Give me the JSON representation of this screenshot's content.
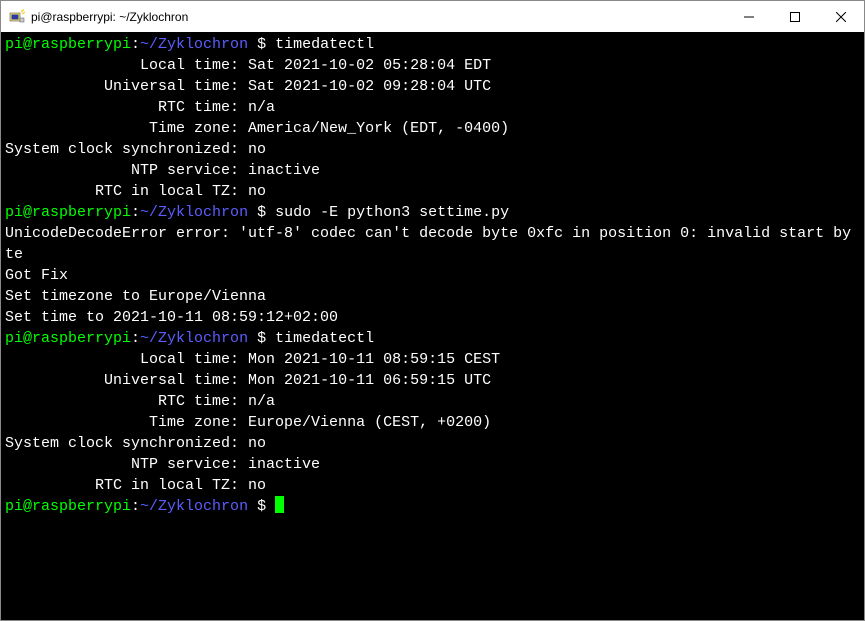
{
  "window": {
    "title": "pi@raspberrypi: ~/Zyklochron"
  },
  "prompt": {
    "user_host": "pi@raspberrypi",
    "separator": ":",
    "path": "~/Zyklochron",
    "symbol": " $ "
  },
  "session": [
    {
      "type": "cmd",
      "command": "timedatectl"
    },
    {
      "type": "out",
      "text": "               Local time: Sat 2021-10-02 05:28:04 EDT"
    },
    {
      "type": "out",
      "text": "           Universal time: Sat 2021-10-02 09:28:04 UTC"
    },
    {
      "type": "out",
      "text": "                 RTC time: n/a"
    },
    {
      "type": "out",
      "text": "                Time zone: America/New_York (EDT, -0400)"
    },
    {
      "type": "out",
      "text": "System clock synchronized: no"
    },
    {
      "type": "out",
      "text": "              NTP service: inactive"
    },
    {
      "type": "out",
      "text": "          RTC in local TZ: no"
    },
    {
      "type": "cmd",
      "command": "sudo -E python3 settime.py"
    },
    {
      "type": "out",
      "text": "UnicodeDecodeError error: 'utf-8' codec can't decode byte 0xfc in position 0: invalid start byte"
    },
    {
      "type": "out",
      "text": "Got Fix"
    },
    {
      "type": "out",
      "text": "Set timezone to Europe/Vienna"
    },
    {
      "type": "out",
      "text": "Set time to 2021-10-11 08:59:12+02:00"
    },
    {
      "type": "cmd",
      "command": "timedatectl"
    },
    {
      "type": "out",
      "text": "               Local time: Mon 2021-10-11 08:59:15 CEST"
    },
    {
      "type": "out",
      "text": "           Universal time: Mon 2021-10-11 06:59:15 UTC"
    },
    {
      "type": "out",
      "text": "                 RTC time: n/a"
    },
    {
      "type": "out",
      "text": "                Time zone: Europe/Vienna (CEST, +0200)"
    },
    {
      "type": "out",
      "text": "System clock synchronized: no"
    },
    {
      "type": "out",
      "text": "              NTP service: inactive"
    },
    {
      "type": "out",
      "text": "          RTC in local TZ: no"
    },
    {
      "type": "cmd",
      "command": "",
      "cursor": true
    }
  ]
}
